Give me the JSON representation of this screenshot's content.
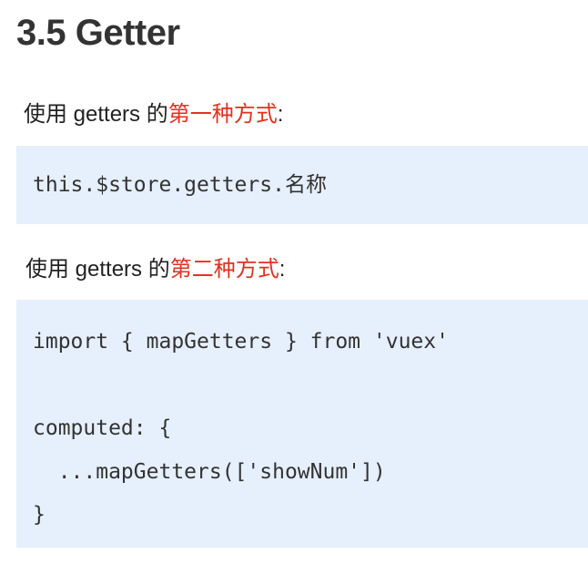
{
  "title": "3.5 Getter",
  "sections": [
    {
      "intro_prefix": "使用 getters 的",
      "intro_accent": "第一种方式",
      "intro_suffix": ":",
      "code_lines": [
        "this.$store.getters.名称"
      ]
    },
    {
      "intro_prefix": "使用 getters 的",
      "intro_accent": "第二种方式",
      "intro_suffix": ":",
      "code_lines": [
        "import { mapGetters } from 'vuex'",
        "",
        "computed: {",
        "  ...mapGetters(['showNum'])",
        "}"
      ]
    }
  ],
  "colors": {
    "accent": "#e0321e",
    "code_background": "#e6effc",
    "text": "#333333"
  }
}
